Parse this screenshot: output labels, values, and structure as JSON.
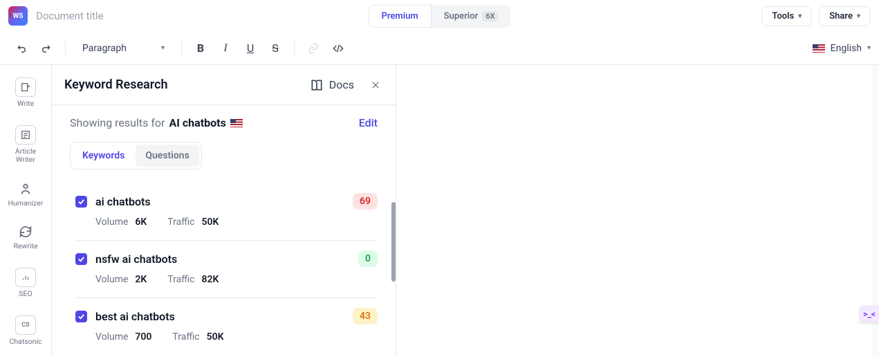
{
  "header": {
    "logo_text": "WS",
    "doc_title": "Document title",
    "premium_label": "Premium",
    "superior_label": "Superior",
    "superior_badge": "6X",
    "tools_label": "Tools",
    "share_label": "Share"
  },
  "toolbar": {
    "style": "Paragraph",
    "language": "English"
  },
  "rail": {
    "items": [
      {
        "label": "Write"
      },
      {
        "label": "Article\nWriter"
      },
      {
        "label": "Humanizer"
      },
      {
        "label": "Rewrite"
      },
      {
        "label": "SEO"
      },
      {
        "label": "Chatsonic"
      }
    ]
  },
  "panel": {
    "title": "Keyword Research",
    "docs_label": "Docs",
    "sub_prefix": "Showing results for",
    "sub_query": "AI chatbots",
    "edit_label": "Edit",
    "tabs": {
      "keywords": "Keywords",
      "questions": "Questions"
    },
    "volume_label": "Volume",
    "traffic_label": "Traffic",
    "keywords": [
      {
        "name": "ai chatbots",
        "score": "69",
        "score_class": "score-red",
        "volume": "6K",
        "traffic": "50K"
      },
      {
        "name": "nsfw ai chatbots",
        "score": "0",
        "score_class": "score-green",
        "volume": "2K",
        "traffic": "82K"
      },
      {
        "name": "best ai chatbots",
        "score": "43",
        "score_class": "score-amber",
        "volume": "700",
        "traffic": "50K"
      }
    ]
  },
  "widget": {
    "glyph": ">_<"
  }
}
